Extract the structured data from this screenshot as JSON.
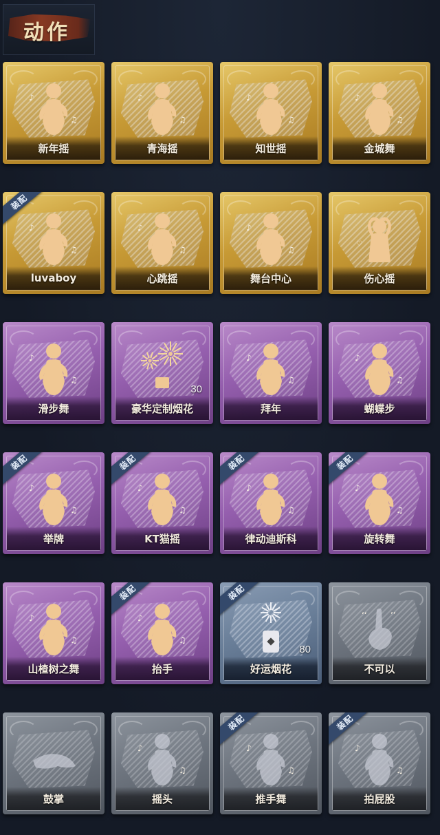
{
  "header": {
    "title": "动作"
  },
  "equip_badge_text": "装配",
  "colors": {
    "gold": "#c79a35",
    "purple": "#955fae",
    "blue": "#6a7f99",
    "grey": "#6e757f",
    "badge": "#34496b",
    "title_brush": "#8c3a22"
  },
  "actions": [
    {
      "label": "新年摇",
      "tier": "gold",
      "equipped": false,
      "icon": "dancer-figure-icon"
    },
    {
      "label": "青海摇",
      "tier": "gold",
      "equipped": false,
      "icon": "dancer-figure-icon"
    },
    {
      "label": "知世摇",
      "tier": "gold",
      "equipped": false,
      "icon": "dancer-figure-icon"
    },
    {
      "label": "金城舞",
      "tier": "gold",
      "equipped": false,
      "icon": "dancer-figure-icon"
    },
    {
      "label": "luvaboy",
      "tier": "gold",
      "equipped": true,
      "icon": "dancer-figure-icon"
    },
    {
      "label": "心跳摇",
      "tier": "gold",
      "equipped": false,
      "icon": "dancer-figure-icon"
    },
    {
      "label": "舞台中心",
      "tier": "gold",
      "equipped": false,
      "icon": "dancer-figure-icon"
    },
    {
      "label": "伤心摇",
      "tier": "gold",
      "equipped": false,
      "icon": "heart-hands-figure-icon"
    },
    {
      "label": "滑步舞",
      "tier": "purple",
      "equipped": false,
      "icon": "dancer-figure-icon"
    },
    {
      "label": "豪华定制烟花",
      "tier": "purple",
      "equipped": false,
      "icon": "fireworks-icon",
      "count": "30"
    },
    {
      "label": "拜年",
      "tier": "purple",
      "equipped": false,
      "icon": "bowing-figure-icon"
    },
    {
      "label": "蝴蝶步",
      "tier": "purple",
      "equipped": false,
      "icon": "dancer-figure-icon"
    },
    {
      "label": "举牌",
      "tier": "purple",
      "equipped": true,
      "icon": "sign-holding-figure-icon"
    },
    {
      "label": "KT猫摇",
      "tier": "purple",
      "equipped": true,
      "icon": "dancer-figure-icon"
    },
    {
      "label": "律动迪斯科",
      "tier": "purple",
      "equipped": true,
      "icon": "disco-figure-icon"
    },
    {
      "label": "旋转舞",
      "tier": "purple",
      "equipped": true,
      "icon": "spinning-figure-icon"
    },
    {
      "label": "山楂树之舞",
      "tier": "purple",
      "equipped": false,
      "icon": "dancer-figure-icon"
    },
    {
      "label": "抬手",
      "tier": "purple",
      "equipped": true,
      "icon": "raising-hand-figure-icon"
    },
    {
      "label": "好运烟花",
      "tier": "blue",
      "equipped": true,
      "icon": "firework-can-icon",
      "count": "80"
    },
    {
      "label": "不可以",
      "tier": "grey",
      "equipped": false,
      "icon": "finger-wag-icon"
    },
    {
      "label": "鼓掌",
      "tier": "grey",
      "equipped": false,
      "icon": "clapping-hands-icon"
    },
    {
      "label": "摇头",
      "tier": "grey",
      "equipped": false,
      "icon": "head-shake-figure-icon"
    },
    {
      "label": "推手舞",
      "tier": "grey",
      "equipped": true,
      "icon": "push-hands-figure-icon"
    },
    {
      "label": "拍屁股",
      "tier": "grey",
      "equipped": true,
      "icon": "butt-slap-figure-icon"
    }
  ]
}
